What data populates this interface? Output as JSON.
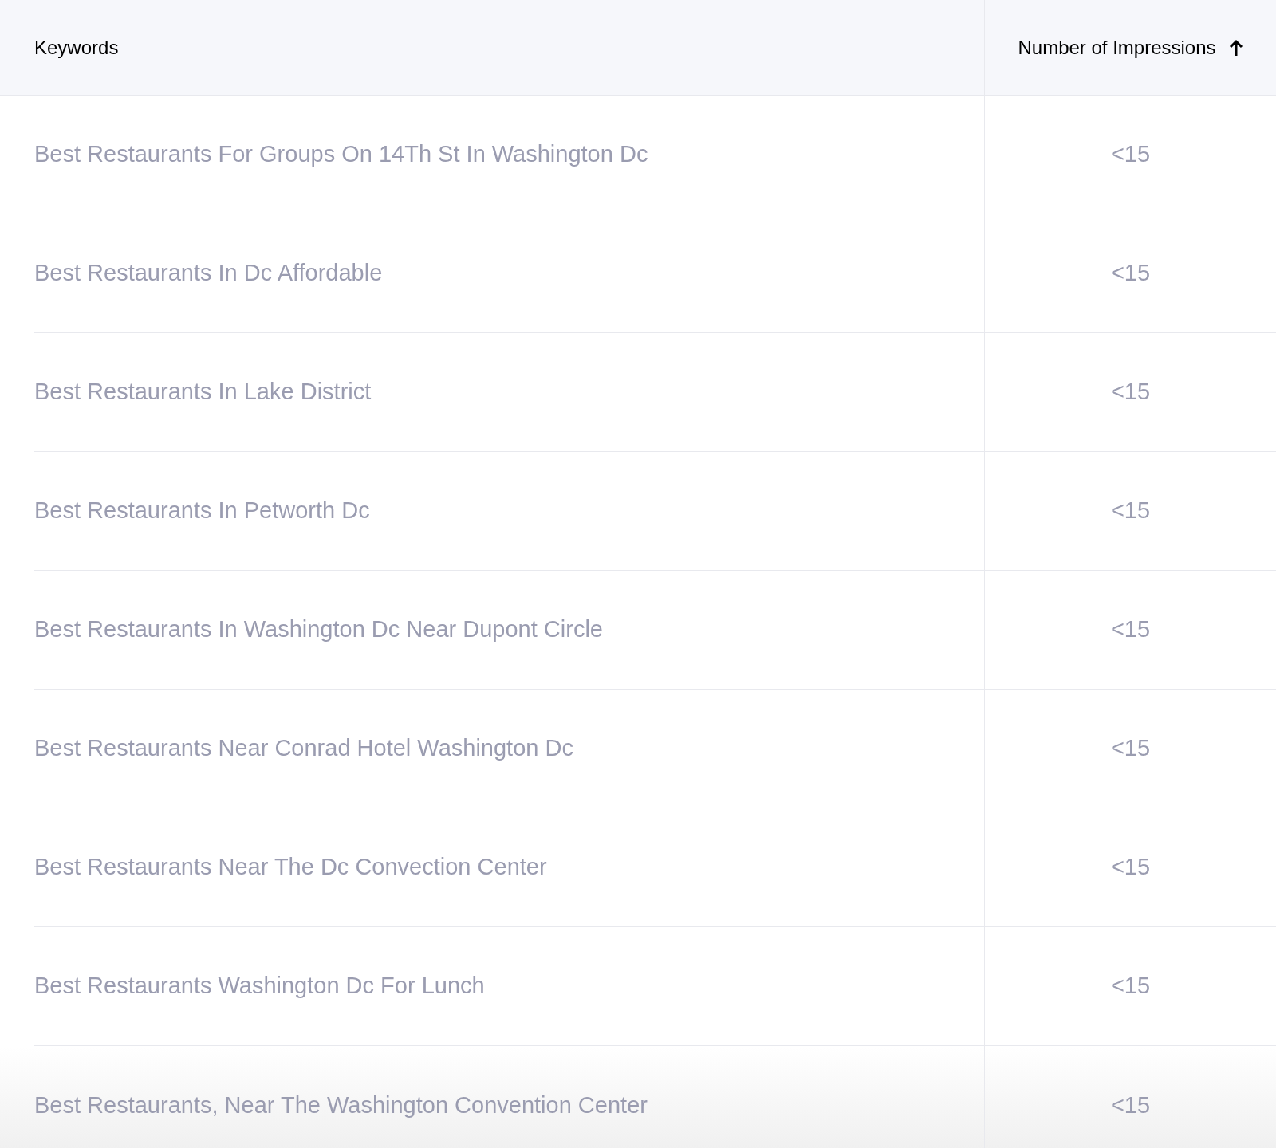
{
  "table": {
    "columns": [
      {
        "label": "Keywords",
        "sorted": false
      },
      {
        "label": "Number of Impressions",
        "sorted": true
      }
    ],
    "rows": [
      {
        "keyword": "Best Restaurants For Groups On 14Th St In Washington Dc",
        "impressions": "<15"
      },
      {
        "keyword": "Best Restaurants In Dc Affordable",
        "impressions": "<15"
      },
      {
        "keyword": "Best Restaurants In Lake District",
        "impressions": "<15"
      },
      {
        "keyword": "Best Restaurants In Petworth Dc",
        "impressions": "<15"
      },
      {
        "keyword": "Best Restaurants In Washington Dc Near Dupont Circle",
        "impressions": "<15"
      },
      {
        "keyword": "Best Restaurants Near Conrad Hotel Washington Dc",
        "impressions": "<15"
      },
      {
        "keyword": "Best Restaurants Near The Dc Convection Center",
        "impressions": "<15"
      },
      {
        "keyword": "Best Restaurants Washington Dc For Lunch",
        "impressions": "<15"
      },
      {
        "keyword": "Best Restaurants, Near The Washington Convention Center",
        "impressions": "<15"
      }
    ]
  }
}
